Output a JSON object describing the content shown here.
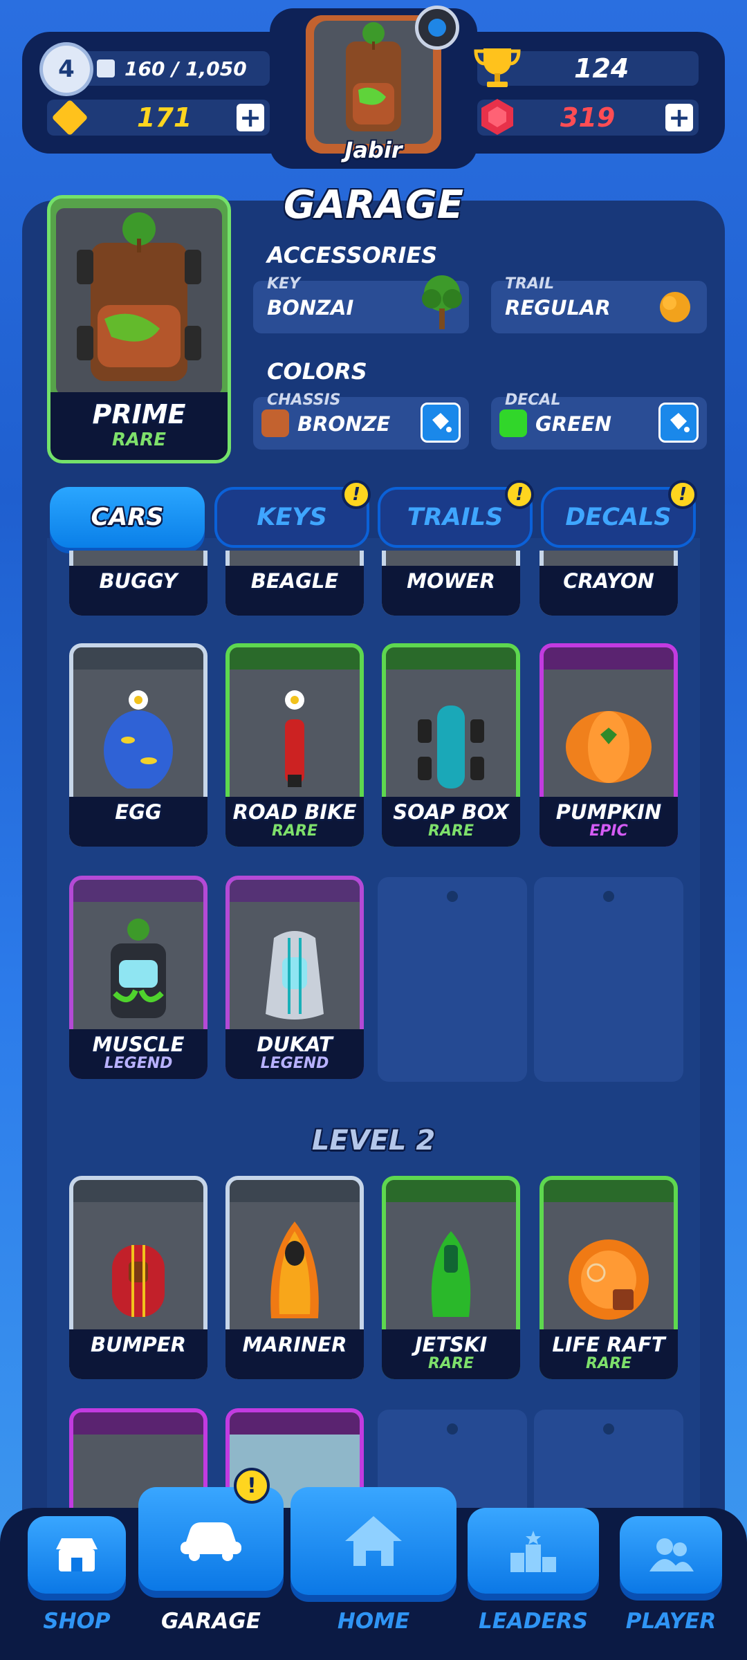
{
  "player": {
    "level": "4",
    "xp": "160 / 1,050",
    "gold": "171",
    "trophies": "124",
    "gems": "319",
    "name": "Jabir"
  },
  "garage": {
    "title": "GARAGE",
    "featured": {
      "name": "PRIME",
      "rarity": "RARE"
    },
    "accessories_title": "ACCESSORIES",
    "key_caption": "KEY",
    "key_value": "BONZAI",
    "trail_caption": "TRAIL",
    "trail_value": "REGULAR",
    "colors_title": "COLORS",
    "chassis_caption": "CHASSIS",
    "chassis_value": "BRONZE",
    "chassis_color": "#c3622f",
    "decal_caption": "DECAL",
    "decal_value": "GREEN",
    "decal_color": "#31d62a"
  },
  "tabs": [
    {
      "label": "CARS",
      "active": true
    },
    {
      "label": "KEYS",
      "badge": "!"
    },
    {
      "label": "TRAILS",
      "badge": "!"
    },
    {
      "label": "DECALS",
      "badge": "!"
    }
  ],
  "cars": [
    {
      "name": "BUGGY",
      "rarity": ""
    },
    {
      "name": "BEAGLE",
      "rarity": ""
    },
    {
      "name": "MOWER",
      "rarity": ""
    },
    {
      "name": "CRAYON",
      "rarity": ""
    },
    {
      "name": "EGG",
      "rarity": ""
    },
    {
      "name": "ROAD BIKE",
      "rarity": "RARE"
    },
    {
      "name": "SOAP BOX",
      "rarity": "RARE"
    },
    {
      "name": "PUMPKIN",
      "rarity": "EPIC"
    },
    {
      "name": "MUSCLE",
      "rarity": "LEGEND"
    },
    {
      "name": "DUKAT",
      "rarity": "LEGEND"
    }
  ],
  "level2_title": "LEVEL 2",
  "level2_cars": [
    {
      "name": "BUMPER",
      "rarity": ""
    },
    {
      "name": "MARINER",
      "rarity": ""
    },
    {
      "name": "JETSKI",
      "rarity": "RARE"
    },
    {
      "name": "LIFE RAFT",
      "rarity": "RARE"
    }
  ],
  "nav": [
    {
      "label": "SHOP"
    },
    {
      "label": "GARAGE",
      "active": true,
      "badge": "!"
    },
    {
      "label": "HOME"
    },
    {
      "label": "LEADERS"
    },
    {
      "label": "PLAYER"
    }
  ]
}
